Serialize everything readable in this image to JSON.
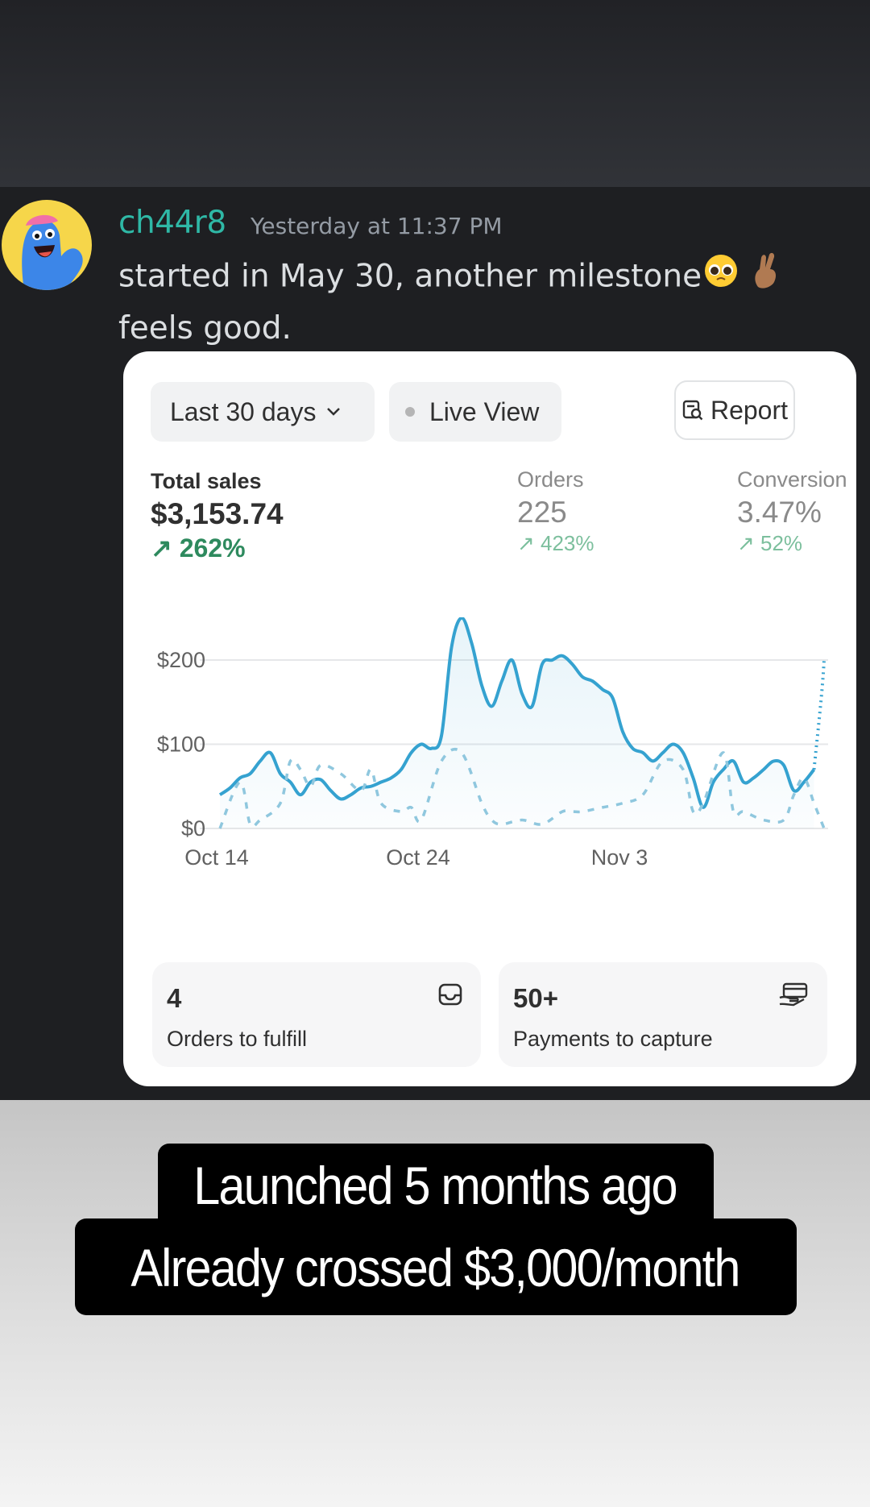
{
  "message": {
    "username": "ch44r8",
    "timestamp": "Yesterday at 11:37 PM",
    "text_line1": "started in May 30, another milestone",
    "text_line2": "feels good.",
    "emojis": [
      "pleading-face",
      "crossed-fingers"
    ]
  },
  "dashboard": {
    "date_range_label": "Last 30 days",
    "live_view_label": "Live View",
    "report_label": "Report",
    "metrics": {
      "total_sales": {
        "label": "Total sales",
        "value": "$3,153.74",
        "change": "↗ 262%"
      },
      "orders": {
        "label": "Orders",
        "value": "225",
        "change": "↗ 423%"
      },
      "conversion": {
        "label": "Conversion",
        "value": "3.47%",
        "change": "↗ 52%"
      }
    },
    "tiles": [
      {
        "count": "4",
        "label": "Orders to fulfill",
        "icon": "inbox-icon"
      },
      {
        "count": "50+",
        "label": "Payments to capture",
        "icon": "payment-hand-icon"
      }
    ],
    "colors": {
      "accent": "#35a2d0",
      "positive": "#2e8a5e",
      "card_bg": "#ffffff"
    }
  },
  "chart_data": {
    "type": "line",
    "y_ticks": [
      "$200",
      "$100",
      "$0"
    ],
    "x_ticks": [
      "Oct 14",
      "Oct 24",
      "Nov 3"
    ],
    "ylim": [
      0,
      200
    ],
    "grid": true,
    "series": [
      {
        "style": "solid",
        "x": [
          0,
          0.5,
          1,
          1.5,
          2,
          2.5,
          3,
          3.5,
          4,
          4.5,
          5,
          5.5,
          6,
          6.5,
          7,
          7.5,
          8,
          8.5,
          9,
          9.5,
          10,
          10.5,
          11,
          11.5,
          12,
          12.5,
          13,
          13.5,
          14,
          14.5,
          15,
          15.5,
          16,
          16.5,
          17,
          17.5,
          18,
          18.5,
          19,
          19.5,
          20,
          20.5,
          21,
          21.5,
          22,
          22.5,
          23,
          23.5,
          24,
          24.5,
          25,
          25.5,
          26,
          26.5,
          27,
          27.5,
          28,
          28.5,
          29,
          29.5,
          30
        ],
        "values": [
          40,
          48,
          60,
          65,
          80,
          90,
          65,
          55,
          40,
          55,
          58,
          45,
          35,
          40,
          48,
          50,
          55,
          60,
          70,
          90,
          100,
          95,
          110,
          215,
          250,
          220,
          170,
          145,
          175,
          200,
          160,
          145,
          195,
          200,
          205,
          195,
          180,
          175,
          165,
          155,
          115,
          95,
          90,
          80,
          90,
          100,
          90,
          60,
          25,
          55,
          70,
          80,
          55,
          60,
          70,
          80,
          75,
          45,
          55,
          70,
          200
        ]
      },
      {
        "style": "dashed",
        "x": [
          0,
          1,
          1.5,
          2,
          3,
          3.5,
          4,
          4.5,
          5,
          6,
          7,
          7.5,
          8,
          9,
          9.5,
          10,
          11,
          12,
          13,
          13.5,
          14,
          15,
          16,
          17,
          17.5,
          18,
          19,
          20,
          21,
          22,
          23,
          23.5,
          24,
          25,
          25.5,
          26,
          27,
          28,
          28.5,
          29,
          29.5,
          30
        ],
        "values": [
          0,
          55,
          5,
          10,
          30,
          80,
          70,
          50,
          75,
          65,
          45,
          70,
          30,
          20,
          25,
          10,
          80,
          90,
          30,
          10,
          5,
          10,
          5,
          20,
          20,
          20,
          25,
          30,
          40,
          80,
          70,
          20,
          30,
          90,
          20,
          20,
          10,
          10,
          40,
          60,
          30,
          0
        ]
      }
    ]
  },
  "caption": {
    "line1": "Launched 5 months ago",
    "line2": "Already crossed $3,000/month"
  }
}
